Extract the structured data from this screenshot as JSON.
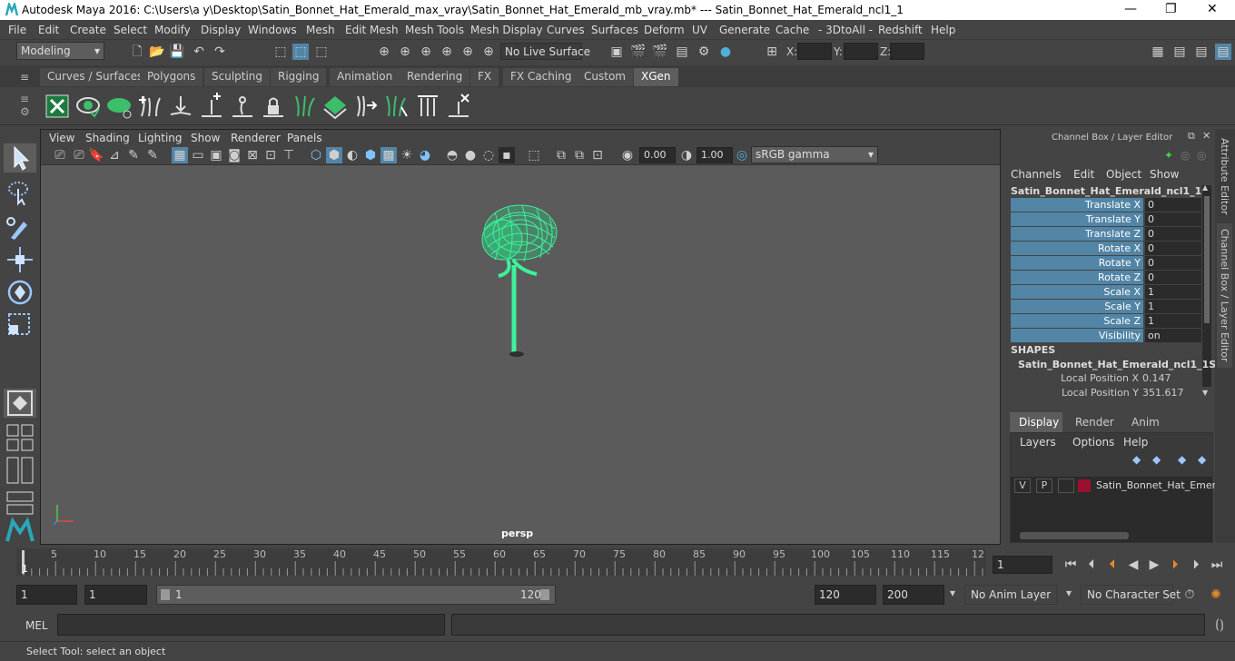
{
  "window": {
    "title": "Autodesk Maya 2016: C:\\Users\\a y\\Desktop\\Satin_Bonnet_Hat_Emerald_max_vray\\Satin_Bonnet_Hat_Emerald_mb_vray.mb*   ---   Satin_Bonnet_Hat_Emerald_ncl1_1"
  },
  "menu": [
    "File",
    "Edit",
    "Create",
    "Select",
    "Modify",
    "Display",
    "Windows",
    "Mesh",
    "Edit Mesh",
    "Mesh Tools",
    "Mesh Display",
    "Curves",
    "Surfaces",
    "Deform",
    "UV",
    "Generate",
    "Cache",
    "- 3DtoAll -",
    "Redshift",
    "Help"
  ],
  "status": {
    "mode": "Modeling",
    "live_surface": "No Live Surface",
    "x_label": "X:",
    "y_label": "Y:",
    "z_label": "Z:"
  },
  "shelf_tabs": [
    "Curves / Surfaces",
    "Polygons",
    "Sculpting",
    "Rigging",
    "Animation",
    "Rendering",
    "FX",
    "FX Caching",
    "Custom",
    "XGen"
  ],
  "shelf_active": "XGen",
  "viewport": {
    "menu": [
      "View",
      "Shading",
      "Lighting",
      "Show",
      "Renderer",
      "Panels"
    ],
    "exposure": "0.00",
    "gamma": "1.00",
    "colorspace": "sRGB gamma",
    "camera": "persp"
  },
  "channel_box": {
    "header": "Channel Box / Layer Editor",
    "menu": [
      "Channels",
      "Edit",
      "Object",
      "Show"
    ],
    "object": "Satin_Bonnet_Hat_Emerald_ncl1_1",
    "channels": [
      {
        "name": "Translate X",
        "value": "0"
      },
      {
        "name": "Translate Y",
        "value": "0"
      },
      {
        "name": "Translate Z",
        "value": "0"
      },
      {
        "name": "Rotate X",
        "value": "0"
      },
      {
        "name": "Rotate Y",
        "value": "0"
      },
      {
        "name": "Rotate Z",
        "value": "0"
      },
      {
        "name": "Scale X",
        "value": "1"
      },
      {
        "name": "Scale Y",
        "value": "1"
      },
      {
        "name": "Scale Z",
        "value": "1"
      },
      {
        "name": "Visibility",
        "value": "on"
      }
    ],
    "shapes_label": "SHAPES",
    "shape_name": "Satin_Bonnet_Hat_Emerald_ncl1_1Sh...",
    "shape_channels": [
      {
        "name": "Local Position X",
        "value": "0.147"
      },
      {
        "name": "Local Position Y",
        "value": "351.617"
      }
    ]
  },
  "layer_editor": {
    "tabs": [
      "Display",
      "Render",
      "Anim"
    ],
    "menu": [
      "Layers",
      "Options",
      "Help"
    ],
    "layer": {
      "v": "V",
      "p": "P",
      "name": "Satin_Bonnet_Hat_Emera",
      "color": "#9b1030"
    }
  },
  "side_tabs": [
    "Attribute Editor",
    "Channel Box / Layer Editor"
  ],
  "timeline": {
    "ticks": [
      "5",
      "10",
      "15",
      "20",
      "25",
      "30",
      "35",
      "40",
      "45",
      "50",
      "55",
      "60",
      "65",
      "70",
      "75",
      "80",
      "85",
      "90",
      "95",
      "100",
      "105",
      "110",
      "115",
      "12"
    ],
    "start_marker": "1",
    "current_frame": "1"
  },
  "range": {
    "start": "1",
    "playback_start": "1",
    "slider_start": "1",
    "slider_end": "120",
    "playback_end": "120",
    "end": "200",
    "anim_layer": "No Anim Layer",
    "character_set": "No Character Set"
  },
  "mel": {
    "label": "MEL"
  },
  "help": {
    "text": "Select Tool: select an object"
  },
  "colors": {
    "accent": "#5285a6",
    "wire": "#3df29a"
  }
}
